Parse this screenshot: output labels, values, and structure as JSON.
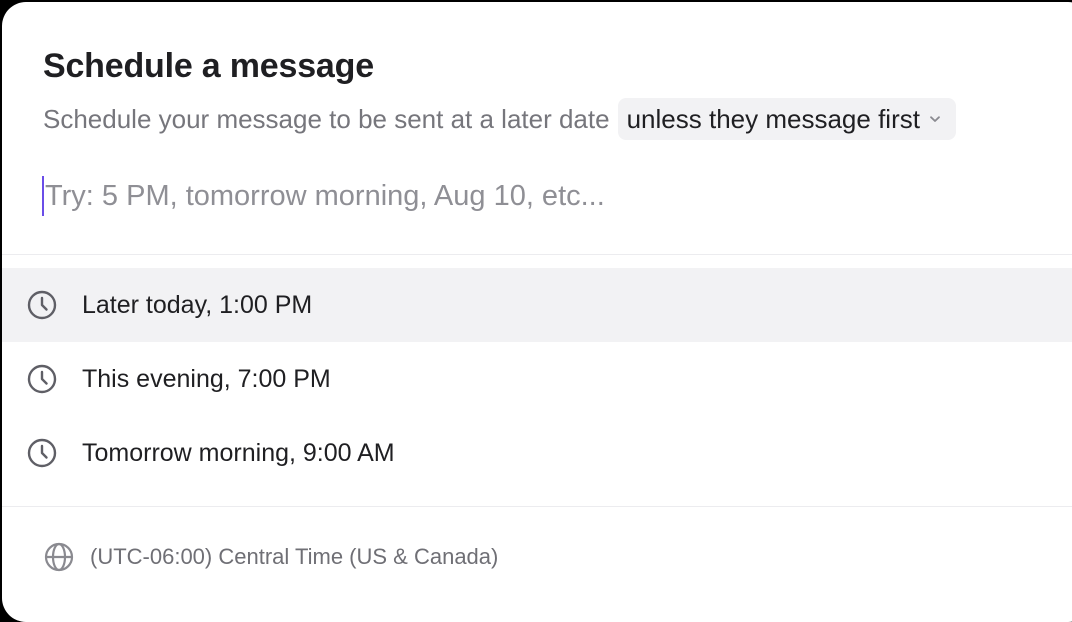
{
  "dialog": {
    "title": "Schedule a message",
    "subtitle": "Schedule your message to be sent at a later date",
    "condition_select": {
      "selected": "unless they message first",
      "icon": "chevron-down-icon"
    }
  },
  "time_input": {
    "value": "",
    "placeholder": "Try: 5 PM, tomorrow morning, Aug 10, etc..."
  },
  "options": [
    {
      "label": "Later today, 1:00 PM",
      "icon": "clock-icon",
      "highlighted": true
    },
    {
      "label": "This evening, 7:00 PM",
      "icon": "clock-icon",
      "highlighted": false
    },
    {
      "label": "Tomorrow morning, 9:00 AM",
      "icon": "clock-icon",
      "highlighted": false
    }
  ],
  "footer": {
    "timezone": "(UTC-06:00) Central Time (US & Canada)",
    "icon": "globe-icon"
  },
  "colors": {
    "caret": "#6a4de8",
    "highlight_bg": "#f2f2f4",
    "text_primary": "#1f1f22",
    "text_secondary": "#76767c"
  }
}
